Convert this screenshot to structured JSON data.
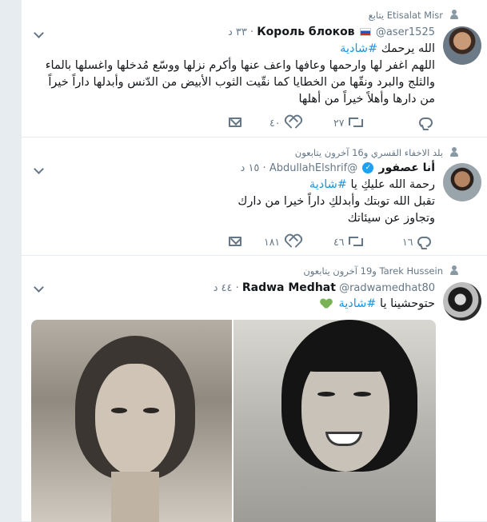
{
  "tweets": [
    {
      "context": "Etisalat Misr يتابع",
      "name": "Король блоков",
      "handle": "@aser1525",
      "time": "٣٣ د",
      "text_prefix": "الله يرحمك ",
      "hashtag": "#شادية",
      "body": "اللهم اغفر لها وارحمها وعافها واعف عنها وأكرم نزلها ووسّع مُدخلها واغسلها بالماء والثلج والبرد ونقّها من الخطايا كما نقّيت الثوب الأبيض من الدّنس وأبدلها داراً خيراً من دارها وأهلاً خيراً من أهلها",
      "retweets": "٢٧",
      "likes": "٤٠"
    },
    {
      "context": "بلد الاخفاء القسري و16 آخرون يتابعون",
      "name": "أنا عصفور",
      "handle": "@AbdullahElshrif",
      "time": "١٥ د",
      "text_prefix": "رحمة الله عليكِ يا ",
      "hashtag": "#شادية",
      "body": "تقبل الله توبتك وأبدلكِ داراً خيرا من دارك وتجاوز عن سيئاتك",
      "retweets": "٤٦",
      "likes": "١٨١",
      "replies": "١٦"
    },
    {
      "context": "Tarek Hussein و19 آخرون يتابعون",
      "name": "Radwa Medhat",
      "handle": "@radwamedhat80",
      "time": "٤٤ د",
      "text_prefix": "حتوحشينا يا ",
      "hashtag": "#شادية",
      "emoji": "green-heart"
    }
  ],
  "colors": {
    "hashtag": "#1b95e0",
    "muted": "#657786",
    "background": "#e6ecf0"
  }
}
